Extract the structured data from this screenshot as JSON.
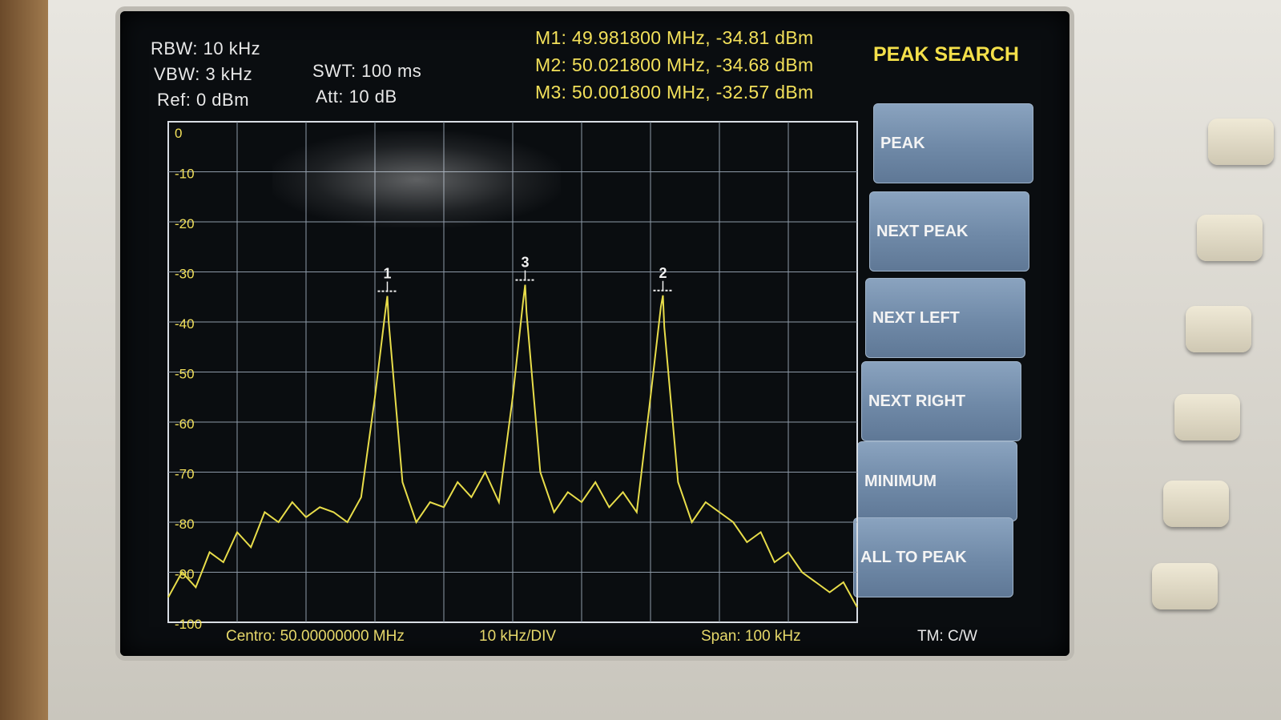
{
  "settings": {
    "rbw": "RBW: 10 kHz",
    "vbw": "VBW: 3 kHz",
    "ref": "Ref: 0 dBm",
    "swt": "SWT: 100 ms",
    "att": "Att: 10 dB"
  },
  "markers": {
    "m1": "M1: 49.981800 MHz, -34.81 dBm",
    "m2": "M2: 50.021800 MHz, -34.68 dBm",
    "m3": "M3: 50.001800 MHz, -32.57 dBm"
  },
  "softmenu": {
    "title": "PEAK SEARCH",
    "keys": [
      "PEAK",
      "NEXT PEAK",
      "NEXT LEFT",
      "NEXT RIGHT",
      "MINIMUM",
      "ALL TO PEAK"
    ]
  },
  "footer": {
    "center": "Centro: 50.00000000 MHz",
    "div": "10 kHz/DIV",
    "span": "Span: 100 kHz",
    "tm": "TM: C/W"
  },
  "colors": {
    "trace": "#e8dd4a",
    "grid": "#8e9aa8",
    "screen_bg": "#0a0d10",
    "marker_text": "#f2e05a"
  },
  "chart_data": {
    "type": "line",
    "xlabel": "",
    "ylabel": "",
    "xlim": [
      49.95,
      50.05
    ],
    "ylim": [
      -100,
      0
    ],
    "grid": true,
    "y_ticks": [
      0,
      -10,
      -20,
      -30,
      -40,
      -50,
      -60,
      -70,
      -80,
      -90,
      -100
    ],
    "tick_labels": [
      "0",
      "-10",
      "-20",
      "-30",
      "-40",
      "-50",
      "-60",
      "-70",
      "-80",
      "-90",
      "-100"
    ],
    "series": [
      {
        "x": [
          49.95,
          49.952,
          49.954,
          49.956,
          49.958,
          49.96,
          49.962,
          49.964,
          49.966,
          49.968,
          49.97,
          49.972,
          49.974,
          49.976,
          49.978,
          49.98,
          49.9815,
          49.9818,
          49.982,
          49.984,
          49.986,
          49.988,
          49.99,
          49.992,
          49.994,
          49.996,
          49.998,
          50.0,
          50.0015,
          50.0018,
          50.002,
          50.004,
          50.006,
          50.008,
          50.01,
          50.012,
          50.014,
          50.016,
          50.018,
          50.02,
          50.0215,
          50.0218,
          50.022,
          50.024,
          50.026,
          50.028,
          50.03,
          50.032,
          50.034,
          50.036,
          50.038,
          50.04,
          50.042,
          50.044,
          50.046,
          50.048,
          50.05
        ],
        "values": [
          -95,
          -90,
          -93,
          -86,
          -88,
          -82,
          -85,
          -78,
          -80,
          -76,
          -79,
          -77,
          -78,
          -80,
          -75,
          -55,
          -38,
          -34.81,
          -40,
          -72,
          -80,
          -76,
          -77,
          -72,
          -75,
          -70,
          -76,
          -55,
          -36,
          -32.57,
          -38,
          -70,
          -78,
          -74,
          -76,
          -72,
          -77,
          -74,
          -78,
          -55,
          -37,
          -34.68,
          -41,
          -72,
          -80,
          -76,
          -78,
          -80,
          -84,
          -82,
          -88,
          -86,
          -90,
          -92,
          -94,
          -92,
          -97
        ]
      }
    ],
    "markers": [
      {
        "label": "1",
        "x": 49.9818,
        "y": -34.81
      },
      {
        "label": "2",
        "x": 50.0218,
        "y": -34.68
      },
      {
        "label": "3",
        "x": 50.0018,
        "y": -32.57
      }
    ]
  }
}
